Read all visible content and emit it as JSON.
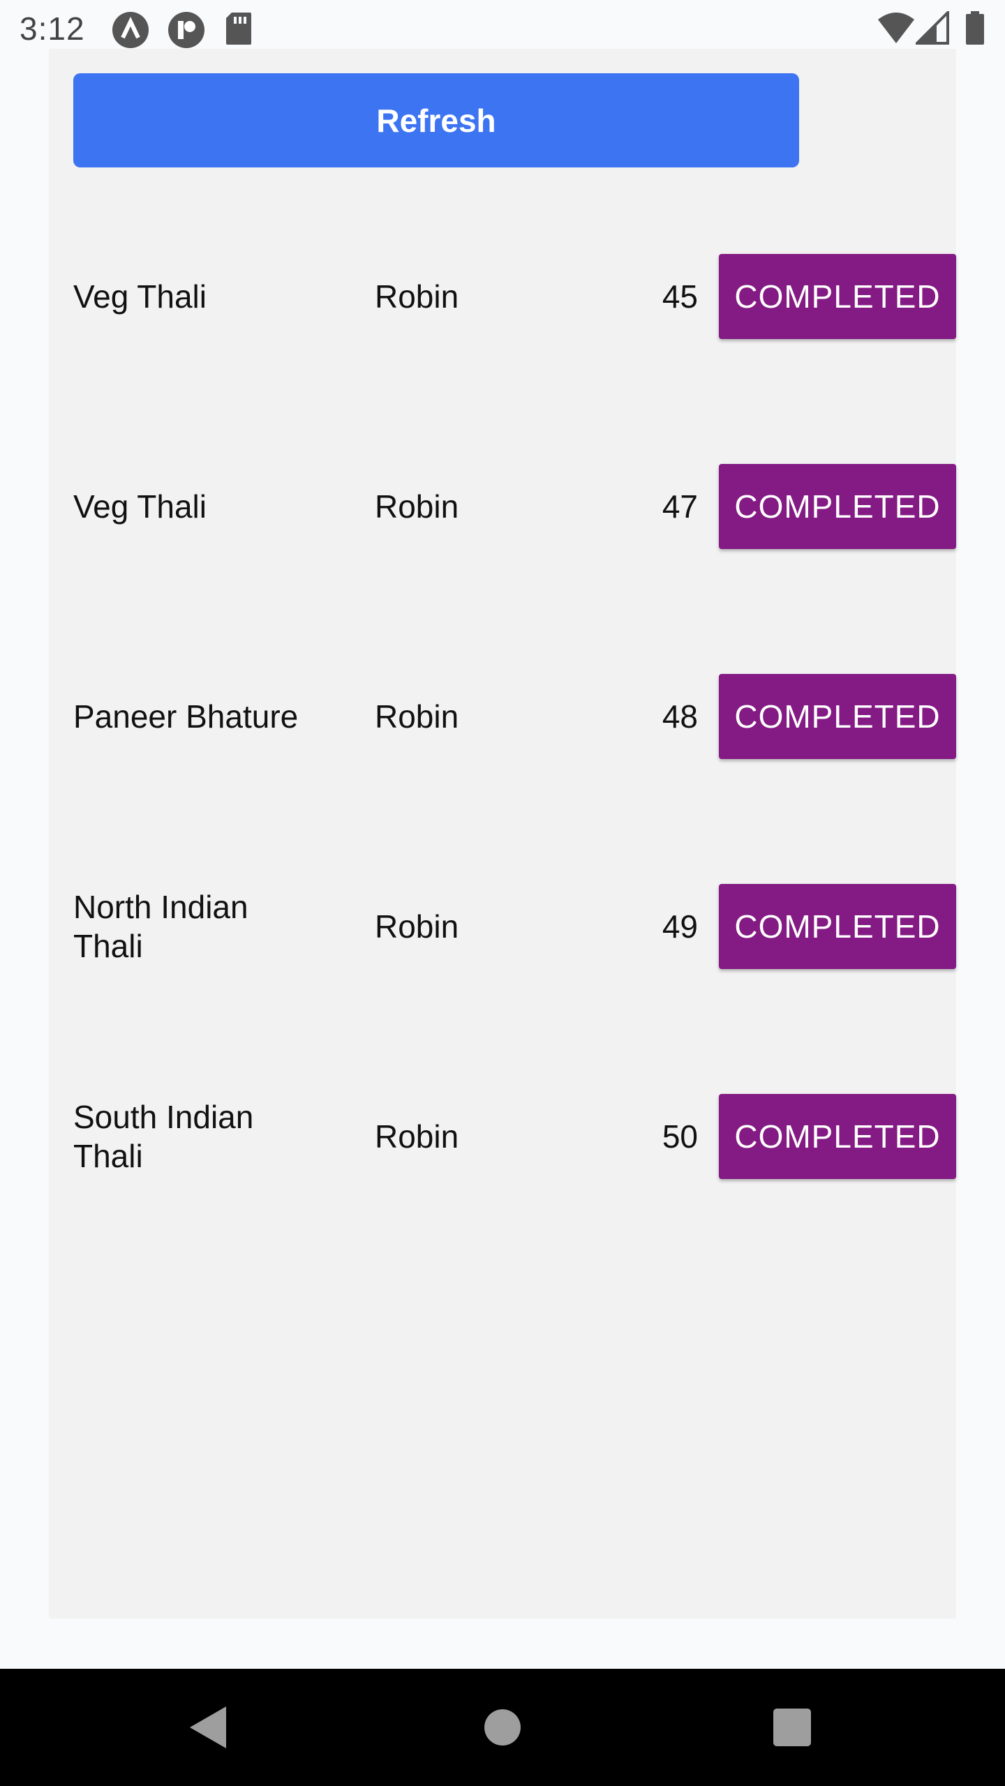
{
  "status_bar": {
    "time": "3:12",
    "icons": [
      "app-a-icon",
      "app-r-icon",
      "sd-card-icon",
      "wifi-icon",
      "cell-signal-icon",
      "battery-icon"
    ]
  },
  "toolbar": {
    "refresh_label": "Refresh"
  },
  "colors": {
    "refresh_button": "#3d74f2",
    "status_button": "#841a84",
    "panel_background": "#f2f2f2"
  },
  "orders": [
    {
      "dish_lines": [
        "Veg Thali"
      ],
      "customer": "Robin",
      "number": "45",
      "status": "COMPLETED"
    },
    {
      "dish_lines": [
        "Veg Thali"
      ],
      "customer": "Robin",
      "number": "47",
      "status": "COMPLETED"
    },
    {
      "dish_lines": [
        "Paneer Bhature"
      ],
      "customer": "Robin",
      "number": "48",
      "status": "COMPLETED"
    },
    {
      "dish_lines": [
        "North Indian",
        "Thali"
      ],
      "customer": "Robin",
      "number": "49",
      "status": "COMPLETED"
    },
    {
      "dish_lines": [
        "South Indian",
        "Thali"
      ],
      "customer": "Robin",
      "number": "50",
      "status": "COMPLETED"
    }
  ],
  "nav_bar": {
    "icons": [
      "back-icon",
      "home-icon",
      "recents-icon"
    ]
  }
}
